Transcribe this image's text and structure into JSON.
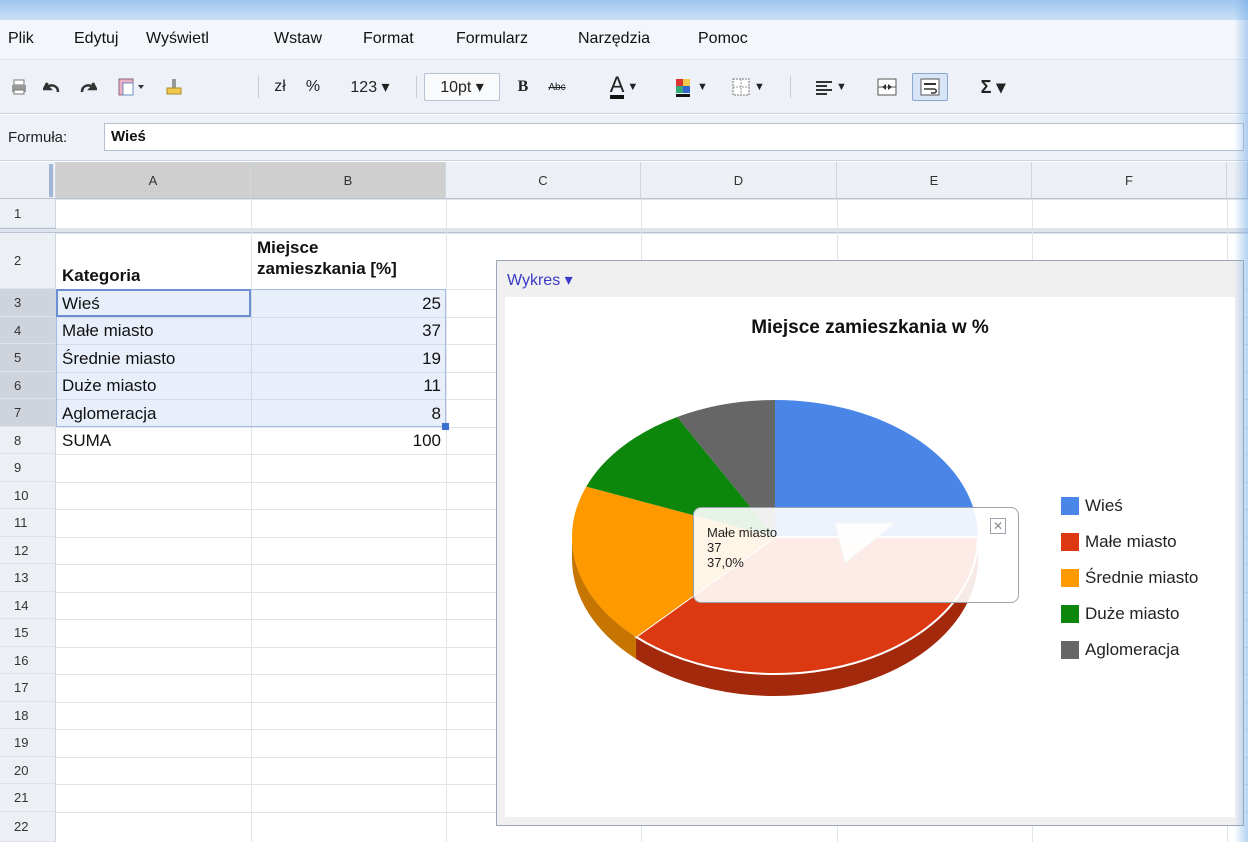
{
  "menu": [
    "Plik",
    "Edytuj",
    "Wyświetl",
    "Wstaw",
    "Format",
    "Formularz",
    "Narzędzia",
    "Pomoc"
  ],
  "toolbar": {
    "currency": "zł",
    "percent": "%",
    "number_format": "123 ▾",
    "font_size": "10pt ▾",
    "bold": "B",
    "strike": "Abc",
    "text_color": "A",
    "sum": "Σ ▾"
  },
  "formula": {
    "label": "Formuła:",
    "value": "Wieś"
  },
  "columns": [
    "A",
    "B",
    "C",
    "D",
    "E",
    "F"
  ],
  "rows": [
    "1",
    "2",
    "3",
    "4",
    "5",
    "6",
    "7",
    "8",
    "9",
    "10",
    "11",
    "12",
    "13",
    "14",
    "15",
    "16",
    "17",
    "18",
    "19",
    "20",
    "21",
    "22"
  ],
  "sheet": {
    "header_a": "Kategoria",
    "header_b_line1": "Miejsce",
    "header_b_line2": "zamieszkania [%]",
    "data": [
      {
        "label": "Wieś",
        "value": "25"
      },
      {
        "label": "Małe miasto",
        "value": "37"
      },
      {
        "label": "Średnie miasto",
        "value": "19"
      },
      {
        "label": "Duże miasto",
        "value": "11"
      },
      {
        "label": "Aglomeracja",
        "value": "8"
      },
      {
        "label": "SUMA",
        "value": "100"
      }
    ]
  },
  "chart_menu": "Wykres ▾",
  "tooltip": {
    "line1": "Małe miasto",
    "line2": "37",
    "line3": "37,0%"
  },
  "chart_data": {
    "type": "pie",
    "title": "Miejsce zamieszkania w %",
    "categories": [
      "Wieś",
      "Małe miasto",
      "Średnie miasto",
      "Duże miasto",
      "Aglomeracja"
    ],
    "values": [
      25,
      37,
      19,
      11,
      8
    ],
    "colors": [
      "#4a86e8",
      "#dc3912",
      "#ff9900",
      "#0c870c",
      "#666666"
    ],
    "dark_colors": [
      "#2f62b3",
      "#a3290c",
      "#c57500",
      "#075f07",
      "#444444"
    ],
    "three_d": true,
    "legend_position": "right",
    "highlighted": "Małe miasto"
  }
}
